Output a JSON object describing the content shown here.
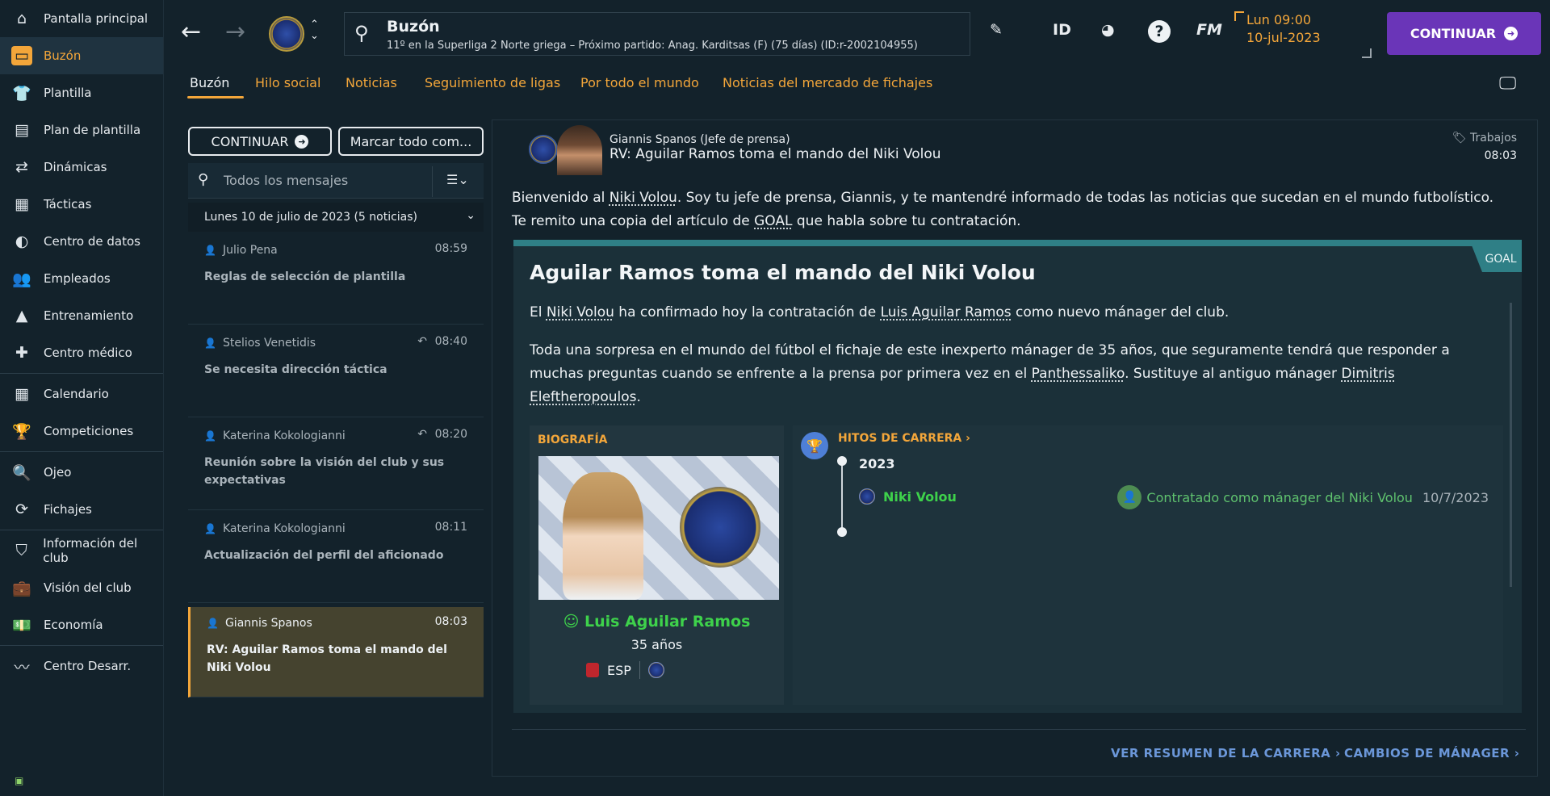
{
  "sidebar": {
    "items": [
      {
        "label": "Pantalla principal",
        "icon": "home-icon"
      },
      {
        "label": "Buzón",
        "icon": "inbox-icon"
      },
      {
        "label": "Plantilla",
        "icon": "shirt-icon"
      },
      {
        "label": "Plan de plantilla",
        "icon": "clipboard-icon"
      },
      {
        "label": "Dinámicas",
        "icon": "dynamics-icon"
      },
      {
        "label": "Tácticas",
        "icon": "tactics-icon"
      },
      {
        "label": "Centro de datos",
        "icon": "data-icon"
      },
      {
        "label": "Empleados",
        "icon": "staff-icon"
      },
      {
        "label": "Entrenamiento",
        "icon": "training-icon"
      },
      {
        "label": "Centro médico",
        "icon": "medical-icon"
      },
      {
        "label": "Calendario",
        "icon": "calendar-icon"
      },
      {
        "label": "Competiciones",
        "icon": "trophy-icon"
      },
      {
        "label": "Ojeo",
        "icon": "scouting-icon"
      },
      {
        "label": "Fichajes",
        "icon": "transfers-icon"
      },
      {
        "label": "Información del club",
        "icon": "shield-icon"
      },
      {
        "label": "Visión del club",
        "icon": "briefcase-icon"
      },
      {
        "label": "Economía",
        "icon": "money-icon"
      },
      {
        "label": "Centro Desarr.",
        "icon": "development-icon"
      }
    ]
  },
  "topbar": {
    "search_title": "Buzón",
    "search_sub": "11º en la Superliga 2 Norte griega – Próximo partido: Anag. Karditsas (F) (75 días) (ID:r-2002104955)",
    "id_label": "ID",
    "fm_label": "FM",
    "date_line1": "Lun 09:00",
    "date_line2": "10-jul-2023",
    "continue_label": "CONTINUAR"
  },
  "tabs": [
    "Buzón",
    "Hilo social",
    "Noticias",
    "Seguimiento de ligas",
    "Por todo el mundo",
    "Noticias del mercado de fichajes"
  ],
  "inbox": {
    "continue_label": "CONTINUAR",
    "mark_all_label": "Marcar todo com...",
    "search_placeholder": "Todos los mensajes",
    "day_header": "Lunes 10 de julio de 2023 (5 noticias)",
    "messages": [
      {
        "from": "Julio Pena",
        "time": "08:59",
        "subject": "Reglas de selección de plantilla"
      },
      {
        "from": "Stelios Venetidis",
        "time": "08:40",
        "subject": "Se necesita dirección táctica"
      },
      {
        "from": "Katerina Kokologianni",
        "time": "08:20",
        "subject": "Reunión sobre la visión del club y sus expectativas"
      },
      {
        "from": "Katerina Kokologianni",
        "time": "08:11",
        "subject": "Actualización del perfil del aficionado"
      },
      {
        "from": "Giannis Spanos",
        "time": "08:03",
        "subject": "RV: Aguilar Ramos toma el mando del Niki Volou"
      }
    ]
  },
  "mail": {
    "sender": "Giannis Spanos  (Jefe de prensa)",
    "subject": "RV: Aguilar Ramos toma el mando del Niki Volou",
    "tag": "Trabajos",
    "time": "08:03",
    "intro_1a": "Bienvenido al ",
    "intro_1b": "Niki Volou",
    "intro_1c": ". Soy tu jefe de prensa, Giannis, y te mantendré informado de todas las noticias que sucedan en el mundo futbolístico.",
    "intro_2a": "Te remito una copia del artículo de ",
    "intro_2b": "GOAL",
    "intro_2c": " que habla sobre tu contratación."
  },
  "article": {
    "badge": "GOAL",
    "title": "Aguilar Ramos toma el mando del Niki Volou",
    "p1a": "El ",
    "p1b": "Niki Volou",
    "p1c": " ha confirmado hoy la contratación de ",
    "p1d": "Luis Aguilar Ramos",
    "p1e": " como nuevo mánager del club.",
    "p2a": "Toda una sorpresa en el mundo del fútbol el fichaje de este inexperto mánager de 35 años, que seguramente tendrá que responder a muchas preguntas cuando se enfrente a la prensa por primera vez en el ",
    "p2b": "Panthessaliko",
    "p2c": ". Sustituye al antiguo mánager ",
    "p2d": "Dimitris Eleftheropoulos",
    "p2e": "."
  },
  "bio": {
    "label": "BIOGRAFÍA",
    "name": "Luis Aguilar Ramos",
    "age": "35 años",
    "nationality": "ESP"
  },
  "milestones": {
    "label": "HITOS DE CARRERA ›",
    "year": "2023",
    "club": "Niki Volou",
    "event": "Contratado como mánager del Niki Volou",
    "date": "10/7/2023"
  },
  "footer": {
    "career_summary": "VER RESUMEN DE LA CARRERA ›",
    "manager_changes": "CAMBIOS DE MÁNAGER ›"
  }
}
